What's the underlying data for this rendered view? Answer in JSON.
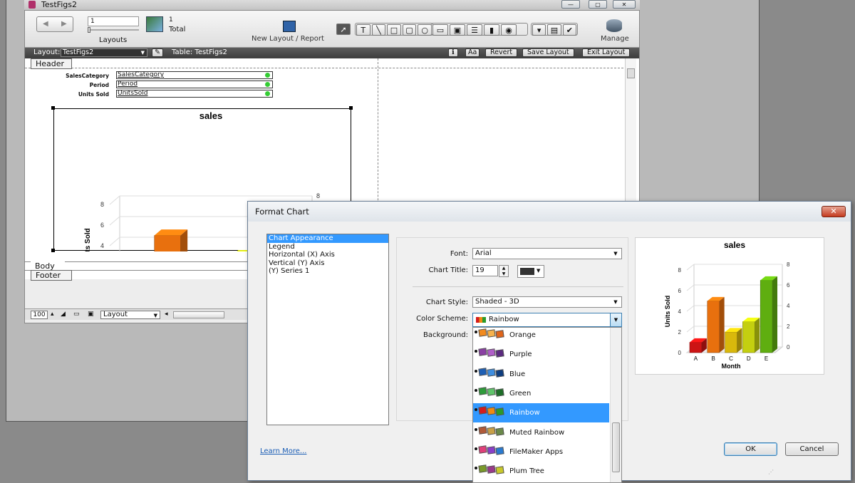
{
  "window": {
    "title": "TestFigs2",
    "controls": {
      "minimize": "—",
      "maximize": "▢",
      "close": "✕"
    }
  },
  "toolbar": {
    "record_value": "1",
    "total_count": "1",
    "total_label": "Total",
    "layouts_label": "Layouts",
    "new_layout_label": "New Layout / Report",
    "manage_label": "Manage"
  },
  "layout_bar": {
    "layout_label": "Layout:",
    "layout_value": "TestFigs2",
    "table_label": "Table: TestFigs2",
    "revert": "Revert",
    "save": "Save Layout",
    "exit": "Exit Layout",
    "aa": "Aa"
  },
  "parts": {
    "header": "Header",
    "body": "Body",
    "footer": "Footer"
  },
  "fields": [
    {
      "label": "SalesCategory",
      "value": "SalesCategory"
    },
    {
      "label": "Period",
      "value": "Period"
    },
    {
      "label": "Units Sold",
      "value": "UnitsSold"
    }
  ],
  "bottom_bar": {
    "zoom": "100",
    "mode": "Layout"
  },
  "chart_data": [
    {
      "type": "bar",
      "style": "3d",
      "title": "sales",
      "xlabel": "Month",
      "ylabel": "Units Sold",
      "categories": [
        "A",
        "B",
        "C",
        "D",
        "E"
      ],
      "values": [
        1,
        5,
        2,
        3,
        7
      ],
      "ylim": [
        0,
        8
      ],
      "yticks": [
        0,
        2,
        4,
        6,
        8
      ],
      "colors": [
        "#cc1414",
        "#e8700e",
        "#d9b80c",
        "#c4cf10",
        "#5fae10"
      ]
    },
    {
      "type": "bar",
      "style": "3d",
      "title": "sales",
      "xlabel": "Month",
      "ylabel": "Units Sold",
      "categories": [
        "A",
        "B",
        "C",
        "D",
        "E"
      ],
      "values": [
        1,
        5,
        2,
        3,
        7
      ],
      "ylim": [
        0,
        8
      ],
      "yticks": [
        0,
        2,
        4,
        6,
        8
      ],
      "colors": [
        "#cc1414",
        "#e8700e",
        "#d9b80c",
        "#c4cf10",
        "#5fae10"
      ]
    }
  ],
  "dialog": {
    "title": "Format Chart",
    "categories": [
      "Chart Appearance",
      "Legend",
      "Horizontal (X) Axis",
      "Vertical (Y) Axis",
      "(Y) Series 1"
    ],
    "font_label": "Font:",
    "font_value": "Arial",
    "title_label": "Chart Title:",
    "title_size": "19",
    "style_label": "Chart Style:",
    "style_value": "Shaded - 3D",
    "scheme_label": "Color Scheme:",
    "scheme_value": "Rainbow",
    "background_label": "Background:",
    "learn_more": "Learn More...",
    "ok": "OK",
    "cancel": "Cancel",
    "scheme_options": [
      {
        "name": "Orange",
        "colors": [
          "#f28a1e",
          "#f6b24c",
          "#e0651a"
        ]
      },
      {
        "name": "Purple",
        "colors": [
          "#8a3fa3",
          "#b05ec8",
          "#5b2a80"
        ]
      },
      {
        "name": "Blue",
        "colors": [
          "#1e5fb4",
          "#3e8ee0",
          "#0f3e80"
        ]
      },
      {
        "name": "Green",
        "colors": [
          "#2e9b3a",
          "#5fc46a",
          "#1d6e28"
        ]
      },
      {
        "name": "Rainbow",
        "colors": [
          "#d41c1c",
          "#f08a12",
          "#2a9a2a"
        ]
      },
      {
        "name": "Muted Rainbow",
        "colors": [
          "#b05a3a",
          "#c8a048",
          "#6a8a4a"
        ]
      },
      {
        "name": "FileMaker Apps",
        "colors": [
          "#e0407a",
          "#8a3fc8",
          "#2a7ad0"
        ]
      },
      {
        "name": "Plum Tree",
        "colors": [
          "#7a9a2a",
          "#9a3a8a",
          "#c8c82a"
        ]
      }
    ]
  }
}
